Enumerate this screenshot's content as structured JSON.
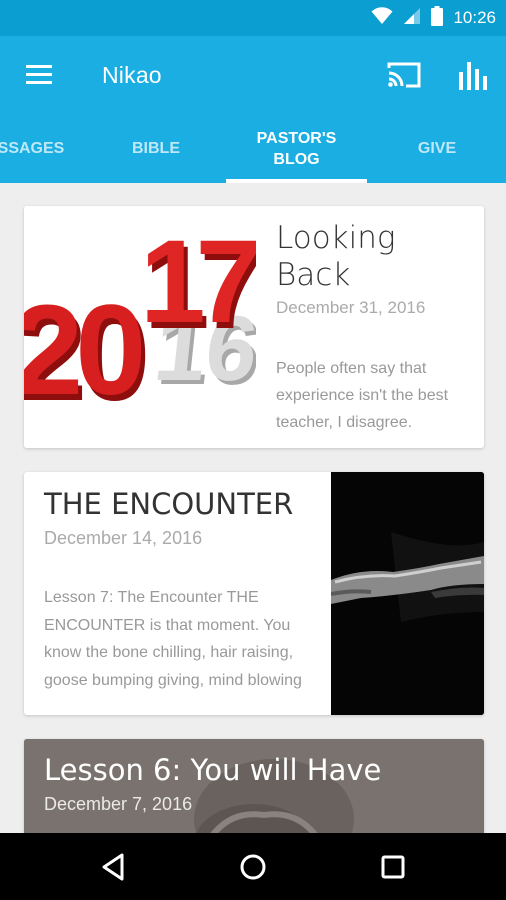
{
  "status_bar": {
    "time": "10:26",
    "icons": [
      "wifi-icon",
      "signal-icon",
      "battery-icon"
    ]
  },
  "app_bar": {
    "title": "Nikao",
    "icons": [
      "menu-icon",
      "cast-icon",
      "bar-chart-icon"
    ],
    "background_color": "#1aaee3"
  },
  "tabs": [
    {
      "label": "SSAGES",
      "active": false
    },
    {
      "label": "BIBLE",
      "active": false
    },
    {
      "label": "PASTOR'S BLOG",
      "active": true
    },
    {
      "label": "GIVE",
      "active": false
    }
  ],
  "posts": [
    {
      "title": "Looking Back",
      "date": "December 31, 2016",
      "excerpt": "People often say that experience isn't the best teacher, I disagree.",
      "image": "2017-over-2016-numbers"
    },
    {
      "title": "THE ENCOUNTER",
      "date": "December 14, 2016",
      "excerpt": "Lesson 7: The Encounter THE ENCOUNTER is that moment. You know the bone chilling, hair raising, goose bumping giving, mind blowing",
      "image": "outstretched-arm-dark"
    },
    {
      "title": "Lesson 6: You will Have",
      "date": "December 7, 2016",
      "image": "person-head-in-hands"
    }
  ],
  "nav_bar": {
    "icons": [
      "back-icon",
      "home-icon",
      "recents-icon"
    ]
  }
}
